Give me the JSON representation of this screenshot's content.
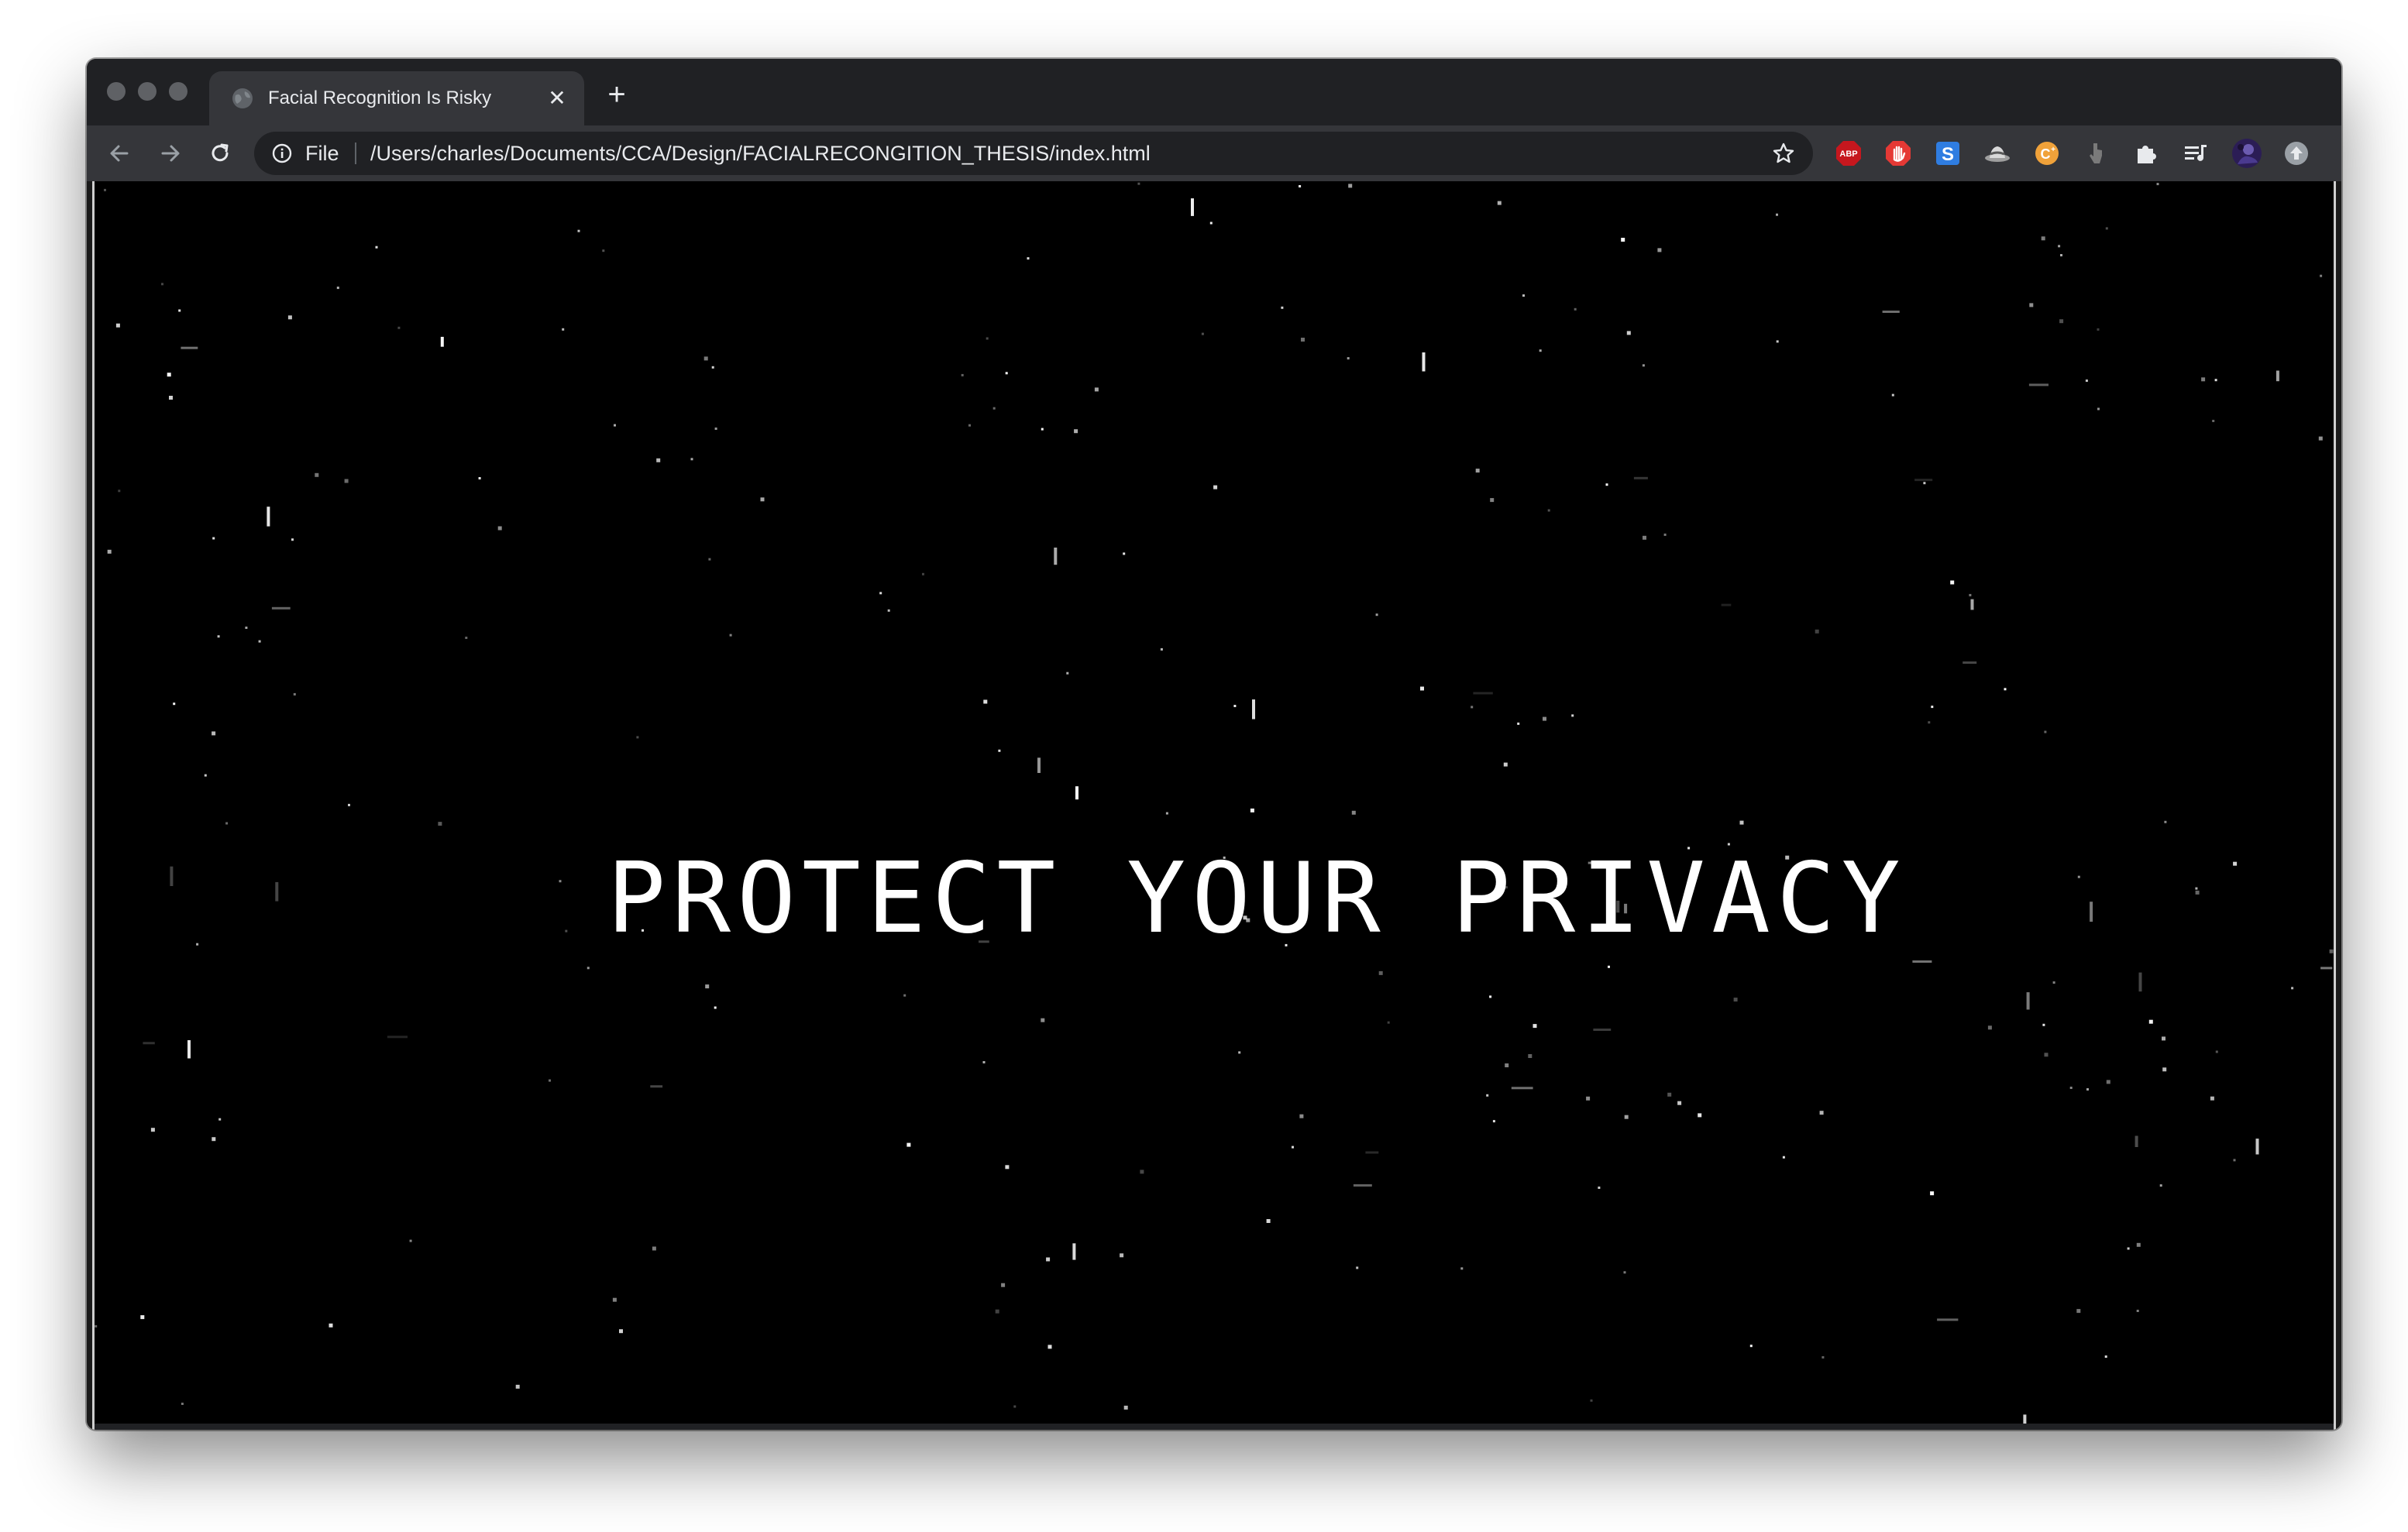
{
  "browser": {
    "tab": {
      "title": "Facial Recognition Is Risky",
      "close_glyph": "✕"
    },
    "new_tab_glyph": "+",
    "address_bar": {
      "scheme_label": "File",
      "url": "/Users/charles/Documents/CCA/Design/FACIALRECONGITION_THESIS/index.html"
    },
    "extensions": [
      {
        "name": "adblock-plus-icon",
        "label": "ABP",
        "color": "#c6171e"
      },
      {
        "name": "hand-stop-icon",
        "color": "#e53935"
      },
      {
        "name": "s-extension-icon",
        "label": "S",
        "color": "#2f7de1"
      },
      {
        "name": "hat-icon",
        "color": "#c9c9c9"
      },
      {
        "name": "honey-coin-icon",
        "label": "C",
        "color": "#f0a23a"
      },
      {
        "name": "cursor-icon",
        "color": "#8a8a8a"
      },
      {
        "name": "puzzle-icon",
        "color": "#e8eaed"
      },
      {
        "name": "media-queue-icon",
        "color": "#e8eaed"
      },
      {
        "name": "profile-avatar",
        "color": "#3b2a7a"
      },
      {
        "name": "update-icon",
        "color": "#9aa0a6"
      }
    ]
  },
  "page": {
    "headline": "PROTECT YOUR PRIVACY",
    "background": "#000000",
    "text_color": "#ffffff"
  }
}
